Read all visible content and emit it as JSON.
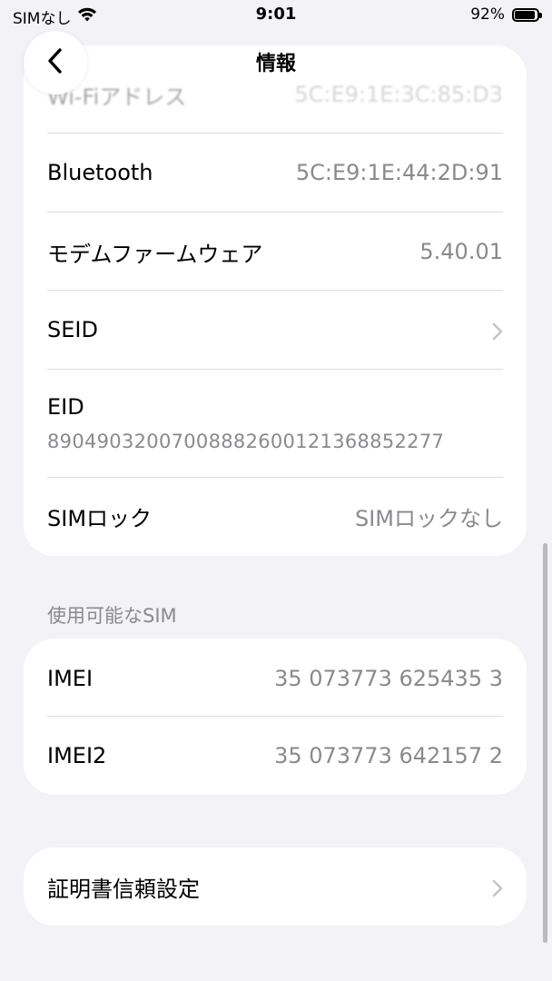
{
  "status_bar": {
    "carrier": "SIMなし",
    "time": "9:01",
    "battery_text": "92%",
    "battery_level": 0.92
  },
  "nav": {
    "title": "情報"
  },
  "info": {
    "wifi_label": "Wi-Fiアドレス",
    "wifi_value": "5C:E9:1E:3C:85:D3",
    "bluetooth_label": "Bluetooth",
    "bluetooth_value": "5C:E9:1E:44:2D:91",
    "modem_label": "モデムファームウェア",
    "modem_value": "5.40.01",
    "seid_label": "SEID",
    "eid_label": "EID",
    "eid_value": "89049032007008882600121368852277",
    "simlock_label": "SIMロック",
    "simlock_value": "SIMロックなし"
  },
  "sim_section": {
    "header": "使用可能なSIM",
    "imei_label": "IMEI",
    "imei_value": "35 073773 625435 3",
    "imei2_label": "IMEI2",
    "imei2_value": "35 073773 642157 2"
  },
  "cert": {
    "label": "証明書信頼設定"
  },
  "colors": {
    "background": "#f2f2f7",
    "card": "#ffffff",
    "secondary_text": "#8a8a8e",
    "chevron": "#c4c4c7"
  }
}
